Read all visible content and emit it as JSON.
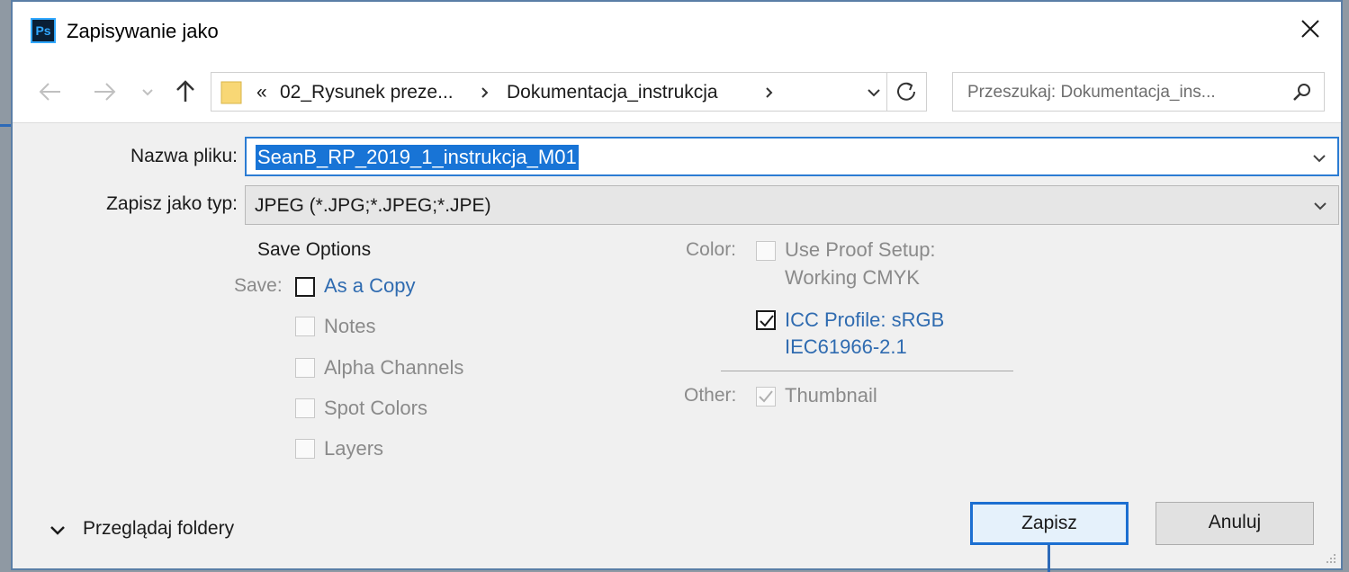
{
  "window": {
    "title": "Zapisywanie jako",
    "app_icon_text": "Ps"
  },
  "nav": {
    "path_overflow": "«",
    "path_segments": [
      "02_Rysunek preze...",
      "Dokumentacja_instrukcja"
    ],
    "search_placeholder": "Przeszukaj: Dokumentacja_ins..."
  },
  "form": {
    "filename_label": "Nazwa pliku:",
    "filename_value": "SeanB_RP_2019_1_instrukcja_M01",
    "filetype_label": "Zapisz jako typ:",
    "filetype_value": "JPEG (*.JPG;*.JPEG;*.JPE)"
  },
  "options": {
    "section_title": "Save Options",
    "save_label": "Save:",
    "save_items": [
      {
        "label": "As a Copy",
        "checked": false,
        "enabled": true
      },
      {
        "label": "Notes",
        "checked": false,
        "enabled": false
      },
      {
        "label": "Alpha Channels",
        "checked": false,
        "enabled": false
      },
      {
        "label": "Spot Colors",
        "checked": false,
        "enabled": false
      },
      {
        "label": "Layers",
        "checked": false,
        "enabled": false
      }
    ],
    "color_label": "Color:",
    "proof_setup": {
      "line1": "Use Proof Setup:",
      "line2": "Working CMYK",
      "checked": false,
      "enabled": false
    },
    "icc_profile": {
      "line1": "ICC Profile:  sRGB",
      "line2": "IEC61966-2.1",
      "checked": true,
      "enabled": true
    },
    "other_label": "Other:",
    "thumbnail": {
      "label": "Thumbnail",
      "checked": true,
      "enabled": false
    }
  },
  "footer": {
    "browse_label": "Przeglądaj foldery",
    "save_button": "Zapisz",
    "cancel_button": "Anuluj"
  },
  "colors": {
    "accent": "#1c6fd1",
    "selection": "#1874d6",
    "link_blue": "#2f6bb0",
    "disabled_text": "#8a8a8a"
  }
}
